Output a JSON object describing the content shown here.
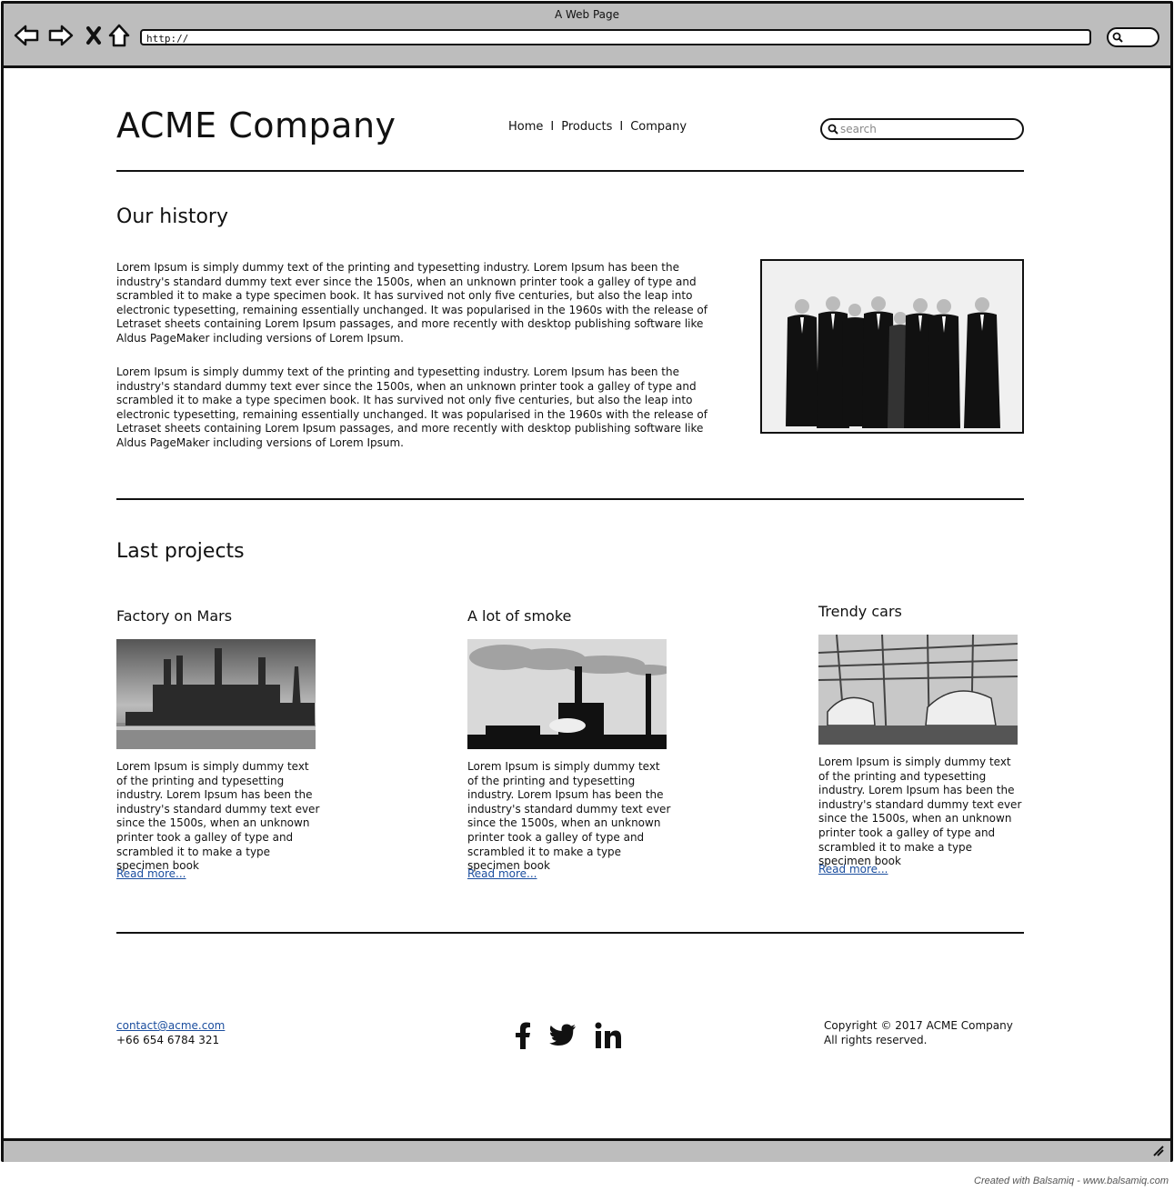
{
  "browser": {
    "window_title": "A Web Page",
    "url": "http://"
  },
  "header": {
    "logo": "ACME Company",
    "nav": [
      "Home",
      "Products",
      "Company"
    ],
    "nav_separator": "I",
    "search_placeholder": "search"
  },
  "history": {
    "heading": "Our history",
    "paragraphs": [
      "Lorem Ipsum is simply dummy text of the printing and typesetting industry. Lorem Ipsum has been the industry's standard dummy text ever since the 1500s, when an unknown printer took a galley of type and scrambled it to make a type specimen book. It has survived not only five centuries, but also the leap into electronic typesetting, remaining essentially unchanged. It was popularised in the 1960s with the release of Letraset sheets containing Lorem Ipsum passages, and more recently with desktop publishing software like Aldus PageMaker including versions of Lorem Ipsum.",
      "Lorem Ipsum is simply dummy text of the printing and typesetting industry. Lorem Ipsum has been the industry's standard dummy text ever since the 1500s, when an unknown printer took a galley of type and scrambled it to make a type specimen book. It has survived not only five centuries, but also the leap into electronic typesetting, remaining essentially unchanged. It was popularised in the 1960s with the release of Letraset sheets containing Lorem Ipsum passages, and more recently with desktop publishing software like Aldus PageMaker including versions of Lorem Ipsum."
    ]
  },
  "projects": {
    "heading": "Last projects",
    "items": [
      {
        "title": "Factory on Mars",
        "text": "Lorem Ipsum is simply dummy text of the printing and typesetting industry. Lorem Ipsum has been the industry's standard dummy text ever since the 1500s, when an unknown printer took a galley of type and scrambled it to make a type specimen book",
        "link": "Read more..."
      },
      {
        "title": "A lot of smoke",
        "text": "Lorem Ipsum is simply dummy text of the printing and typesetting industry. Lorem Ipsum has been the industry's standard dummy text ever since the 1500s, when an unknown printer took a galley of type and scrambled it to make a type specimen book",
        "link": "Read more..."
      },
      {
        "title": "Trendy cars",
        "text": "Lorem Ipsum is simply dummy text of the printing and typesetting industry. Lorem Ipsum has been the industry's standard dummy text ever since the 1500s, when an unknown printer took a galley of type and scrambled it to make a type specimen book",
        "link": "Read more..."
      }
    ]
  },
  "footer": {
    "email": "contact@acme.com",
    "phone": "+66 654 6784 321",
    "social_icons": [
      "facebook-icon",
      "twitter-icon",
      "linkedin-icon"
    ],
    "copyright_line1": "Copyright © 2017 ACME Company",
    "copyright_line2": "All rights reserved."
  },
  "credit": "Created with Balsamiq - www.balsamiq.com",
  "colors": {
    "chrome": "#bdbdbd",
    "link": "#1a4d9e",
    "ink": "#111111"
  }
}
